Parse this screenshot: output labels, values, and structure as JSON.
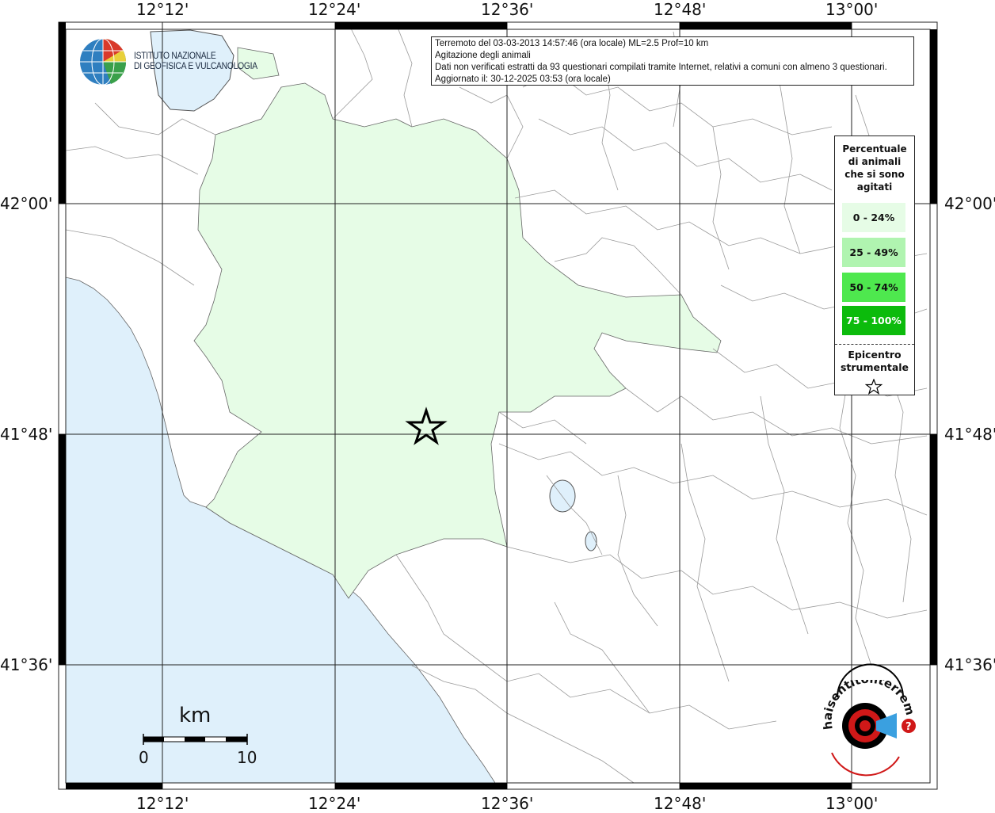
{
  "info": {
    "line1": "Terremoto del 03-03-2013 14:57:46 (ora locale) ML=2.5 Prof=10 km",
    "line2": "Agitazione degli animali",
    "line3": "Dati non verificati estratti da 93 questionari compilati tramite Internet, relativi a comuni con almeno 3 questionari.",
    "line4": "Aggiornato il: 30-12-2025 03:53 (ora locale)"
  },
  "axes": {
    "lon_labels": [
      "12°12'",
      "12°24'",
      "12°36'",
      "12°48'",
      "13°00'"
    ],
    "lat_labels": [
      "42°00'",
      "41°48'",
      "41°36'"
    ]
  },
  "legend": {
    "title": "Percentuale di animali che si sono agitati",
    "items": [
      {
        "label": "0 - 24%",
        "color": "#e6fce6"
      },
      {
        "label": "25 - 49%",
        "color": "#b0f4b0"
      },
      {
        "label": "50 - 74%",
        "color": "#4ee84e"
      },
      {
        "label": "75 - 100%",
        "color": "#0cbb0c"
      }
    ],
    "epicenter_label": "Epicentro strumentale"
  },
  "logos": {
    "ingv_line1": "ISTITUTO NAZIONALE",
    "ingv_line2": "DI GEOFISICA E VULCANOLOGIA",
    "hsit": "haisentitoilterremoto.it"
  },
  "scale": {
    "unit": "km",
    "start": "0",
    "end": "10"
  },
  "colors": {
    "sea": "#dff0fb",
    "affected": "#e6fce6",
    "grid": "#222222"
  }
}
